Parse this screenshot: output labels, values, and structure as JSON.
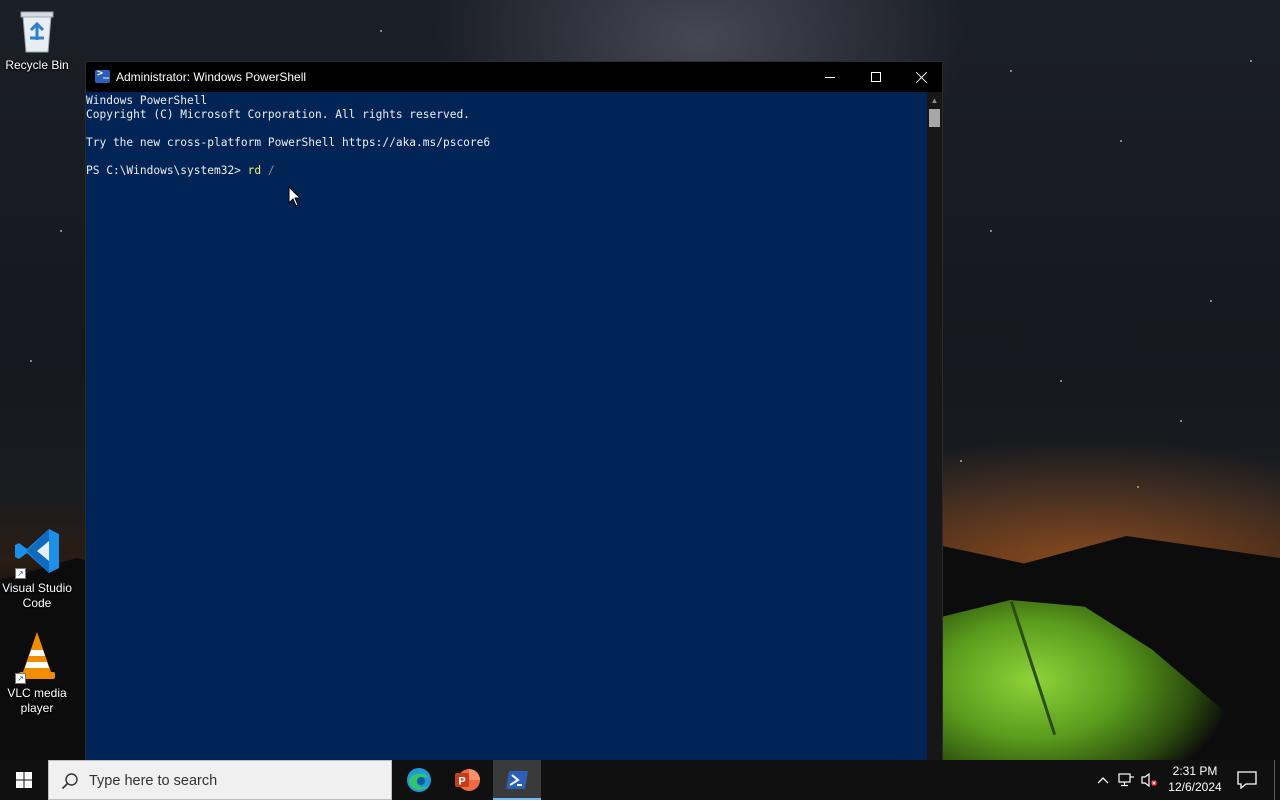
{
  "desktop": {
    "icons": [
      {
        "label": "Recycle Bin",
        "icon": "recycle-bin-icon"
      },
      {
        "label": "Visual Studio Code",
        "icon": "vscode-icon"
      },
      {
        "label": "VLC media player",
        "icon": "vlc-icon"
      }
    ]
  },
  "window": {
    "title": "Administrator: Windows PowerShell",
    "icon": "powershell-icon",
    "controls": [
      "minimize",
      "maximize",
      "close"
    ]
  },
  "console": {
    "lines": [
      "Windows PowerShell",
      "Copyright (C) Microsoft Corporation. All rights reserved.",
      "",
      "Try the new cross-platform PowerShell https://aka.ms/pscore6",
      ""
    ],
    "prompt": {
      "text": "PS C:\\Windows\\system32> ",
      "command": "rd",
      "argument": " /"
    }
  },
  "taskbar": {
    "search_placeholder": "Type here to search",
    "apps": [
      {
        "name": "Microsoft Edge",
        "icon": "edge-icon",
        "active": false
      },
      {
        "name": "PowerPoint",
        "icon": "powerpoint-icon",
        "active": false
      },
      {
        "name": "Windows PowerShell",
        "icon": "powershell-icon",
        "active": true
      }
    ],
    "tray": [
      "chevron-up-icon",
      "network-icon",
      "volume-muted-icon"
    ],
    "clock": {
      "time": "2:31 PM",
      "date": "12/6/2024"
    }
  },
  "colors": {
    "console_bg": "#012456",
    "console_fg": "#eeedf0",
    "command": "#f5f56a",
    "argument": "#8a8f99",
    "taskbar": "#101010",
    "accent": "#76b9ed"
  }
}
